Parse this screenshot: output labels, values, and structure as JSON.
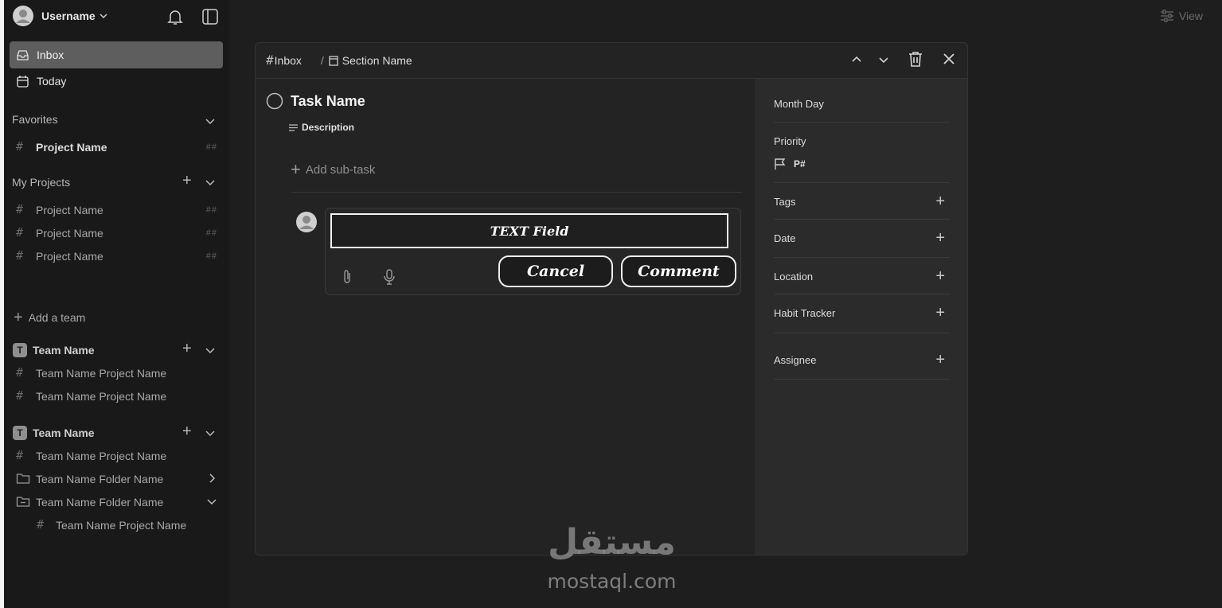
{
  "sidebar": {
    "username": "Username",
    "inbox": "Inbox",
    "today": "Today",
    "favorites": {
      "title": "Favorites",
      "items": [
        {
          "label": "Project Name",
          "count": "##"
        }
      ]
    },
    "my_projects": {
      "title": "My Projects",
      "items": [
        {
          "label": "Project Name",
          "count": "##"
        },
        {
          "label": "Project Name",
          "count": "##"
        },
        {
          "label": "Project Name",
          "count": "##"
        }
      ]
    },
    "add_team": "Add a team",
    "team1": {
      "badge": "T",
      "name": "Team Name",
      "items": [
        "Team Name Project Name",
        "Team Name Project Name"
      ]
    },
    "team2": {
      "badge": "T",
      "name": "Team Name",
      "project": "Team Name Project Name",
      "folder1": "Team Name Folder Name",
      "folder2": "Team Name Folder Name",
      "nested_project": "Team Name Project Name"
    }
  },
  "topbar": {
    "view_label": "View"
  },
  "modal": {
    "breadcrumb": {
      "project": "Inbox",
      "separator": "/",
      "section": "Section Name"
    },
    "task": {
      "name": "Task Name",
      "description": "Description",
      "add_subtask": "Add sub-task"
    },
    "comment": {
      "text_field": "TEXT Field",
      "cancel": "Cancel",
      "comment": "Comment"
    },
    "props": {
      "date_value": "Month Day",
      "priority_label": "Priority",
      "priority_value": "P#",
      "tags": "Tags",
      "date": "Date",
      "location": "Location",
      "habit_tracker": "Habit Tracker",
      "assignee": "Assignee"
    }
  },
  "watermark": {
    "arabic": "مستقل",
    "latin": "mostaql.com"
  }
}
